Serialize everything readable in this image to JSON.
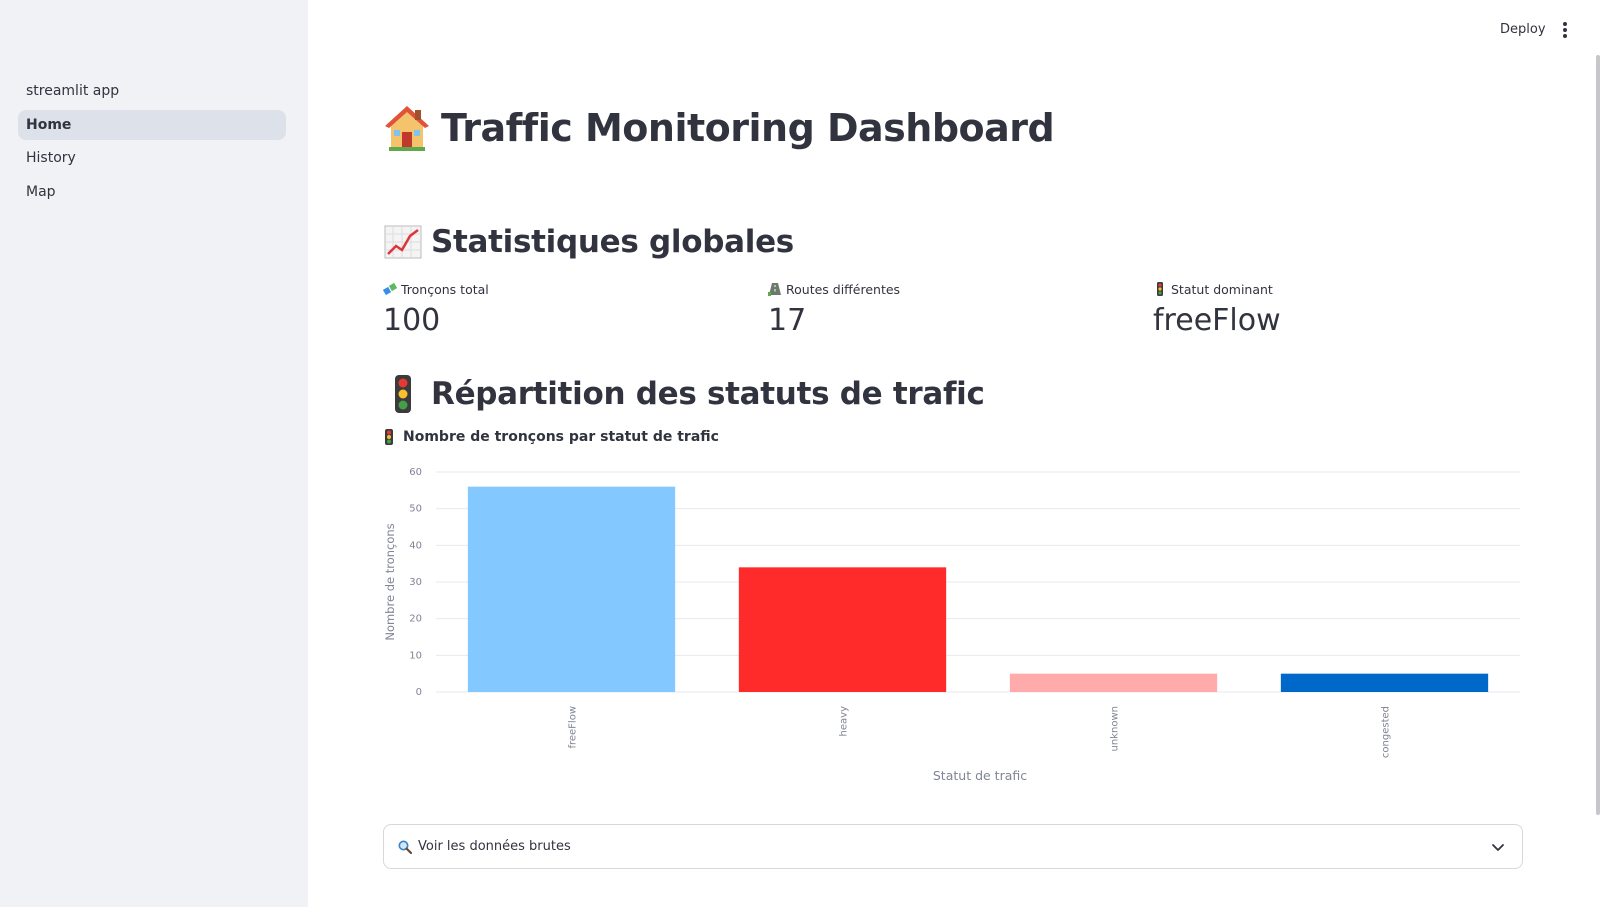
{
  "sidebar": {
    "items": [
      {
        "label": "streamlit app"
      },
      {
        "label": "Home"
      },
      {
        "label": "History"
      },
      {
        "label": "Map"
      }
    ]
  },
  "header": {
    "deploy_label": "Deploy",
    "menu_icon": "kebab-menu-icon"
  },
  "page": {
    "title": "Traffic Monitoring Dashboard",
    "title_icon": "house-emoji-icon",
    "stats_heading": "Statistiques globales",
    "stats_icon": "chart-increasing-icon",
    "distribution_heading": "Répartition des statuts de trafic",
    "distribution_icon": "traffic-light-icon"
  },
  "metrics": [
    {
      "label": "Tronçons total",
      "value": "100",
      "icon": "route-segments-icon"
    },
    {
      "label": "Routes différentes",
      "value": "17",
      "icon": "road-icon"
    },
    {
      "label": "Statut dominant",
      "value": "freeFlow",
      "icon": "traffic-light-icon"
    }
  ],
  "chart_subtitle": "Nombre de tronçons par statut de trafic",
  "chart_data": {
    "type": "bar",
    "categories": [
      "freeFlow",
      "heavy",
      "unknown",
      "congested"
    ],
    "values": [
      56,
      34,
      5,
      5
    ],
    "colors": [
      "#83c9ff",
      "#ff2b2b",
      "#ffabab",
      "#0068c9"
    ],
    "title": "Nombre de tronçons par statut de trafic",
    "xlabel": "Statut de trafic",
    "ylabel": "Nombre de tronçons",
    "ylim": [
      0,
      60
    ],
    "yticks": [
      0,
      10,
      20,
      30,
      40,
      50,
      60
    ],
    "grid": true
  },
  "expander": {
    "label": "Voir les données brutes",
    "icon": "magnifier-icon"
  }
}
